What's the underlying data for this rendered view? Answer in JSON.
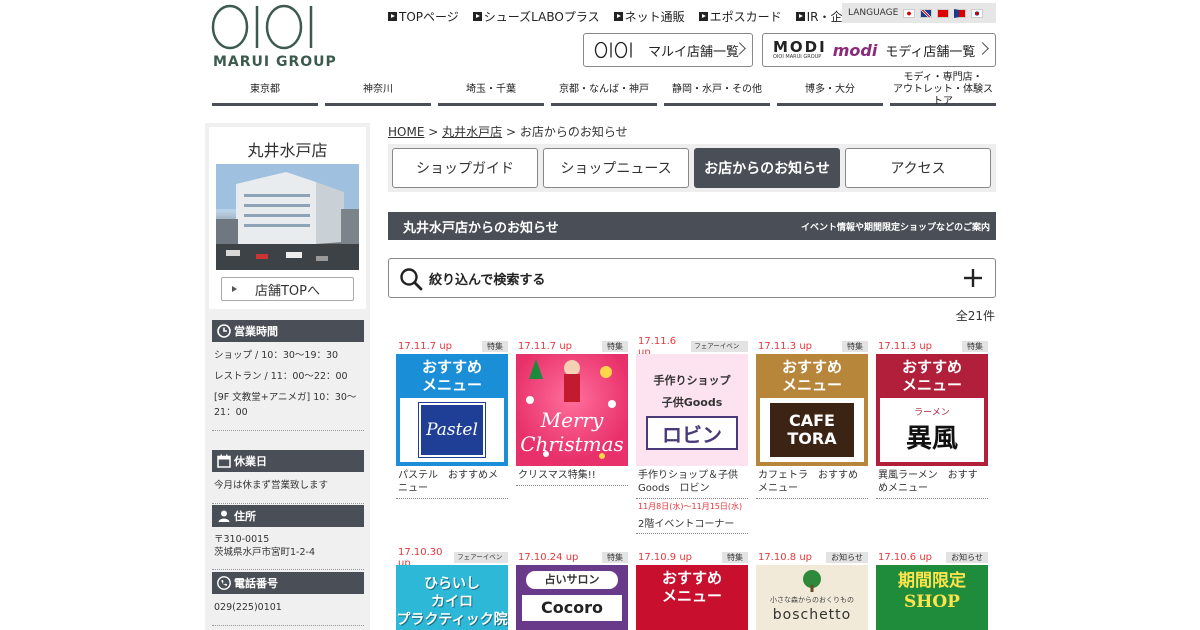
{
  "header": {
    "logo_text": "MARUI GROUP",
    "topnav": [
      "TOPページ",
      "シューズLABOプラス",
      "ネット通販",
      "エポスカード",
      "IR・企業情報"
    ],
    "language_label": "LANGUAGE",
    "marui_btn_label": "マルイ店舗一覧",
    "modi_btn_label": "モディ店舗一覧",
    "modi_logo_text": "MODI",
    "modi_logo_sub": "OIOI MARUI GROUP",
    "modi_logo_script": "modi"
  },
  "areanav": [
    {
      "label": "東京都"
    },
    {
      "label": "神奈川"
    },
    {
      "label": "埼玉・千葉"
    },
    {
      "label": "京都・なんば・神戸"
    },
    {
      "label": "静岡・水戸・その他"
    },
    {
      "label": "博多・大分"
    },
    {
      "label": "モディ・専門店・\nアウトレット・体験ストア"
    }
  ],
  "sidebar": {
    "store_name": "丸井水戸店",
    "top_button": "店舗TOPへ",
    "hours_title": "営業時間",
    "hours": [
      "ショップ / 10：30〜19：30",
      "レストラン / 11：00〜22：00",
      "[9F 文教堂+アニメガ] 10：30〜21：00"
    ],
    "holiday_title": "休業日",
    "holiday": "今月は休まず営業致します",
    "address_title": "住所",
    "address_zip": "〒310-0015",
    "address": "茨城県水戸市宮町1-2-4",
    "phone_title": "電話番号",
    "phone": "029(225)0101"
  },
  "breadcrumb": {
    "home": "HOME",
    "store": "丸井水戸店",
    "current": "お店からのお知らせ",
    "sep": ">"
  },
  "tabs": [
    {
      "label": "ショップガイド",
      "active": false
    },
    {
      "label": "ショップニュース",
      "active": false
    },
    {
      "label": "お店からのお知らせ",
      "active": true
    },
    {
      "label": "アクセス",
      "active": false
    }
  ],
  "section": {
    "title": "丸井水戸店からのお知らせ",
    "subtitle": "イベント情報や期間限定ショップなどのご案内"
  },
  "search": {
    "label": "絞り込んで検索する"
  },
  "count": "全21件",
  "cards": [
    {
      "date": "17.11.7 up",
      "tag": "特集",
      "title": "パステル　おすすめメニュー",
      "rec": "おすすめ\nメニュー",
      "brand": "Pastel",
      "color": "#1a8fd8"
    },
    {
      "date": "17.11.7 up",
      "tag": "特集",
      "title": "クリスマス特集!!",
      "xmas": "Merry\nChristmas"
    },
    {
      "date": "17.11.6 up",
      "tag": "フェアーイベント",
      "title": "手作りショップ＆子供Goods　ロビン",
      "period": "11月8日(水)〜11月15日(水)",
      "sub": "2階イベントコーナー",
      "robin_top": "手作りショップ",
      "robin_mid": "子供Goods",
      "robin_name": "ロビン"
    },
    {
      "date": "17.11.3 up",
      "tag": "特集",
      "title": "カフェトラ　おすすめメニュー",
      "rec": "おすすめ\nメニュー",
      "brand": "CAFE\nTORA",
      "color": "#b8863b"
    },
    {
      "date": "17.11.3 up",
      "tag": "特集",
      "title": "異風ラーメン　おすすめメニュー",
      "rec": "おすすめ\nメニュー",
      "brand": "異風",
      "brand_small": "ラーメン",
      "color": "#b21f3a"
    },
    {
      "date": "17.10.30 up",
      "tag": "フェアーイベント",
      "img_text": "ひらいし\nカイロ\nプラクティック院"
    },
    {
      "date": "17.10.24 up",
      "tag": "特集",
      "img_text": "占いサロン",
      "img_text2": "Cocoro"
    },
    {
      "date": "17.10.9 up",
      "tag": "特集",
      "rec": "おすすめ\nメニュー"
    },
    {
      "date": "17.10.8 up",
      "tag": "お知らせ",
      "img_text": "小さな森からのおくりもの",
      "img_text2": "boschetto"
    },
    {
      "date": "17.10.6 up",
      "tag": "お知らせ",
      "img_text": "期間限定\nSHOP"
    }
  ],
  "colors": {
    "dark": "#4a4f57",
    "accent_red": "#e4383d",
    "logo_green": "#3d5a4f"
  }
}
